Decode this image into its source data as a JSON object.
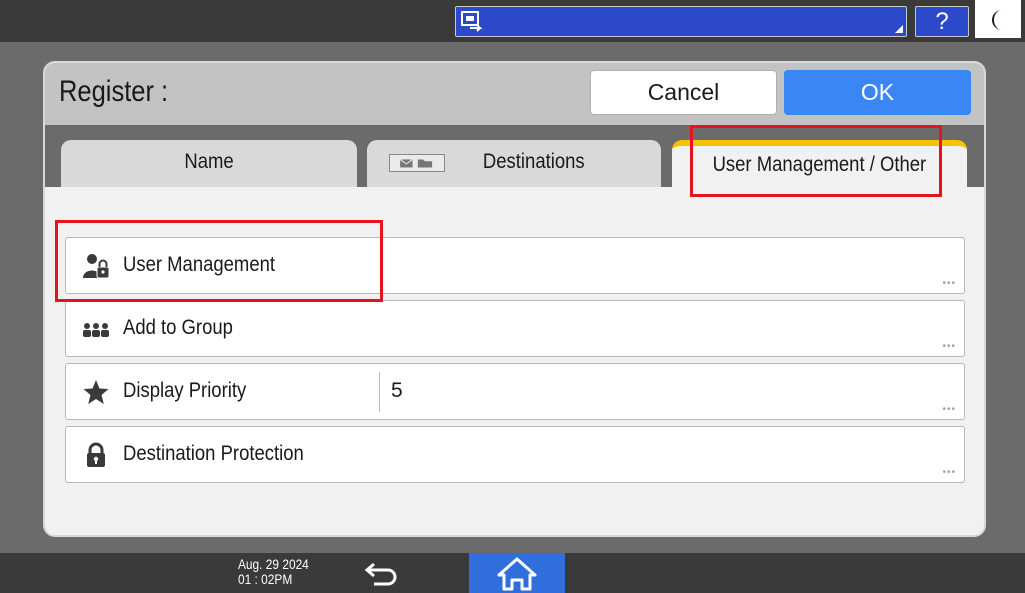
{
  "topbar": {
    "help_label": "?",
    "screen_icon": "screen-switch-icon",
    "energy_icon": "moon-icon"
  },
  "dialog": {
    "title": "Register :",
    "cancel_label": "Cancel",
    "ok_label": "OK"
  },
  "tabs": [
    {
      "label": "Name",
      "selected": false
    },
    {
      "label": "Destinations",
      "selected": false,
      "icon": "email-folder-icon"
    },
    {
      "label": "User Management / Other",
      "selected": true
    }
  ],
  "rows": [
    {
      "label": "User Management",
      "icon": "user-lock-icon",
      "value": ""
    },
    {
      "label": "Add to Group",
      "icon": "group-icon",
      "value": ""
    },
    {
      "label": "Display Priority",
      "icon": "star-icon",
      "value": "5"
    },
    {
      "label": "Destination Protection",
      "icon": "lock-icon",
      "value": ""
    }
  ],
  "status": {
    "date": "Aug. 29 2024",
    "time": "01 : 02PM"
  },
  "colors": {
    "accent_blue": "#3a86f4",
    "tab_selected": "#f5c300",
    "highlight_red": "#e3141b"
  }
}
